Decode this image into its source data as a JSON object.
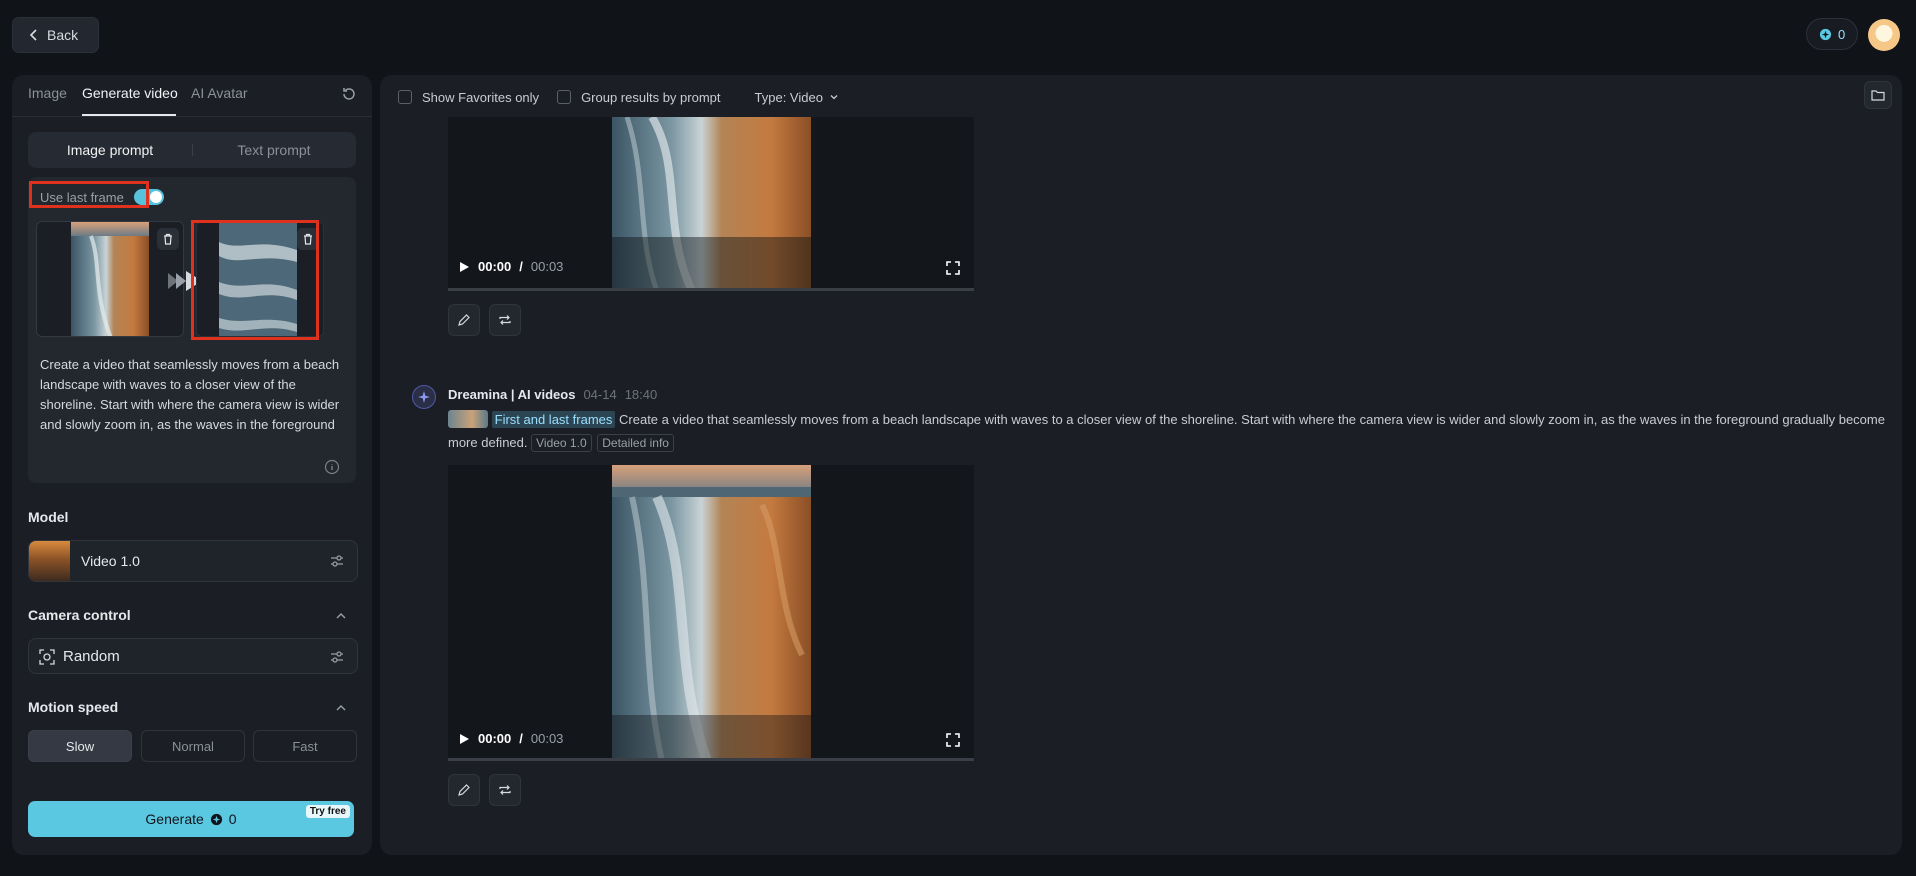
{
  "topbar": {
    "back_label": "Back",
    "credits": "0"
  },
  "sidebar": {
    "tabs": [
      {
        "label": "Image",
        "active": false
      },
      {
        "label": "Generate video",
        "active": true
      },
      {
        "label": "AI Avatar",
        "active": false
      }
    ],
    "prompt_mode": {
      "options": [
        "Image prompt",
        "Text prompt"
      ],
      "selected": "Image prompt"
    },
    "use_last_frame": {
      "label": "Use last frame",
      "enabled": true
    },
    "prompt_text": "Create a video that seamlessly moves from a beach landscape with waves to a closer view of the shoreline. Start with where the camera view is wider and slowly zoom in, as the waves in the foreground gradually become more defined.",
    "model": {
      "section_label": "Model",
      "name": "Video 1.0"
    },
    "camera": {
      "section_label": "Camera control",
      "value": "Random"
    },
    "motion_speed": {
      "section_label": "Motion speed",
      "options": [
        "Slow",
        "Normal",
        "Fast"
      ],
      "selected": "Slow"
    },
    "generate": {
      "label": "Generate",
      "cost": "0",
      "badge": "Try free"
    }
  },
  "main": {
    "filters": {
      "favorites_label": "Show Favorites only",
      "group_label": "Group results by prompt",
      "type_label": "Type: Video"
    },
    "videos": [
      {
        "current": "00:00",
        "duration": "00:03"
      },
      {
        "current": "00:00",
        "duration": "00:03"
      }
    ],
    "message": {
      "author": "Dreamina | AI videos",
      "date": "04-14",
      "time": "18:40",
      "frames_tag": "First and last frames",
      "prompt": "Create a video that seamlessly moves from a beach landscape with waves to a closer view of the shoreline. Start with where the camera view is wider and slowly zoom in, as the waves in the foreground gradually become more defined.",
      "tags": [
        "Video 1.0",
        "Detailed info"
      ]
    }
  },
  "colors": {
    "accent": "#5bc8e2",
    "highlight_box": "#e0301e",
    "background": "#101318",
    "panel": "#1b1e25"
  }
}
